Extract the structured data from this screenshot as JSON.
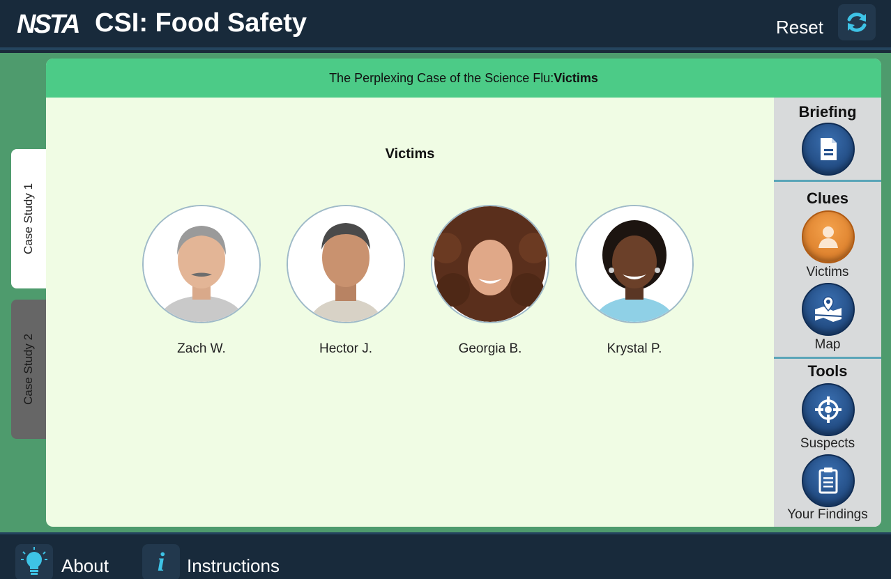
{
  "header": {
    "logo_text": "NSTA",
    "app_title": "CSI: Food Safety",
    "reset_label": "Reset"
  },
  "tabs": [
    {
      "label": "Case Study 1",
      "active": true
    },
    {
      "label": "Case Study 2",
      "active": false
    }
  ],
  "panel": {
    "title_prefix": "The Perplexing Case of the Science Flu:",
    "title_section": "Victims"
  },
  "main": {
    "section_title": "Victims",
    "victims": [
      {
        "name": "Zach W."
      },
      {
        "name": "Hector J."
      },
      {
        "name": "Georgia B."
      },
      {
        "name": "Krystal P."
      }
    ]
  },
  "sidebar": {
    "briefing_heading": "Briefing",
    "clues_heading": "Clues",
    "tools_heading": "Tools",
    "victims_label": "Victims",
    "map_label": "Map",
    "suspects_label": "Suspects",
    "findings_label": "Your Findings"
  },
  "footer": {
    "about_label": "About",
    "instructions_label": "Instructions",
    "info_glyph": "i"
  },
  "colors": {
    "header_bg": "#182a3b",
    "panel_header": "#4ccb87",
    "stage_bg": "#4e9b6d",
    "content_bg": "#f0fce4",
    "sidebar_bg": "#d8dadb",
    "button_blue": "#1f4c8a",
    "button_orange": "#e8892f",
    "icon_cyan": "#3ec3e6"
  }
}
